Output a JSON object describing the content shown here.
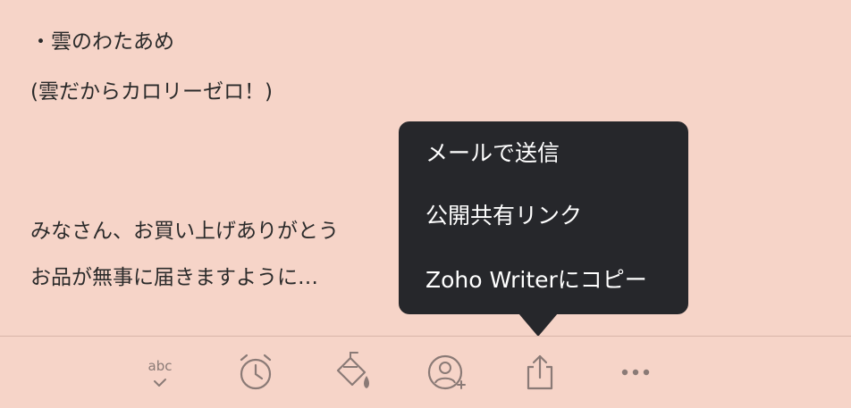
{
  "note": {
    "lines": [
      "・雲のわたあめ",
      "(雲だからカロリーゼロ！)",
      "",
      "みなさん、お買い上げありがとう",
      "お品が無事に届きますように…"
    ]
  },
  "share_menu": {
    "items": [
      {
        "label": "メールで送信"
      },
      {
        "label": "公開共有リンク"
      },
      {
        "label": "Zoho Writerにコピー"
      }
    ]
  },
  "toolbar": {
    "spellcheck_label": "abc",
    "tools": [
      "spellcheck-icon",
      "alarm-clock-icon",
      "paint-bucket-icon",
      "add-user-icon",
      "share-icon",
      "more-icon"
    ]
  },
  "colors": {
    "background": "#f6d4c8",
    "popup": "#26272b",
    "icon": "#8a7a76"
  }
}
